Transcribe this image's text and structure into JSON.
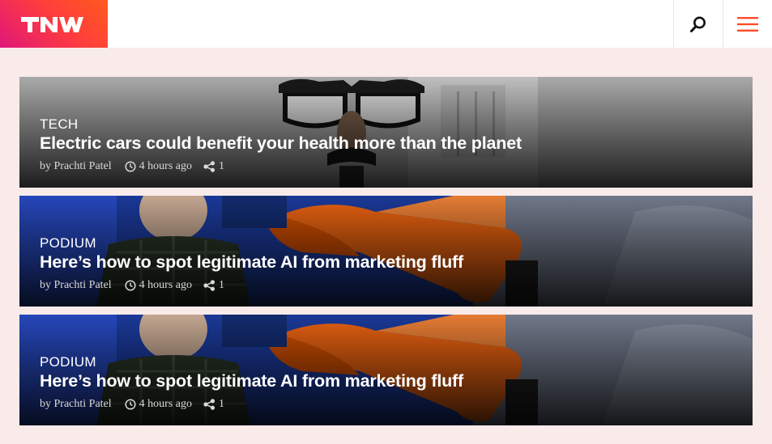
{
  "header": {
    "logo_text": "TNW",
    "search_icon": "search-icon",
    "menu_icon": "hamburger-menu-icon",
    "brand_gradient": [
      "#e0177a",
      "#ff5a1f"
    ],
    "menu_color": "#ff4c29"
  },
  "articles": [
    {
      "category": "TECH",
      "title": "Electric cars could benefit your health more than the planet",
      "author": "by Prachti Patel",
      "time": "4 hours ago",
      "shares": "1"
    },
    {
      "category": "PODIUM",
      "title": "Here’s how to spot legitimate AI from marketing fluff",
      "author": "by Prachti Patel",
      "time": "4 hours ago",
      "shares": "1"
    },
    {
      "category": "PODIUM",
      "title": "Here’s how to spot legitimate AI from marketing fluff",
      "author": "by Prachti Patel",
      "time": "4 hours ago",
      "shares": "1"
    }
  ]
}
